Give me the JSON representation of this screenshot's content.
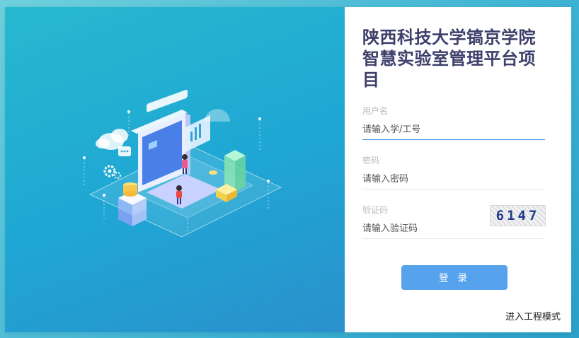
{
  "app": {
    "title": "陕西科技大学镐京学院智慧实验室管理平台项目"
  },
  "form": {
    "username": {
      "label": "用户名",
      "placeholder": "请输入学/工号"
    },
    "password": {
      "label": "密码",
      "placeholder": "请输入密码"
    },
    "captcha": {
      "label": "验证码",
      "placeholder": "请输入验证码",
      "image_text": "6147"
    }
  },
  "actions": {
    "login_label": "登 录",
    "engineering_mode_label": "进入工程模式"
  },
  "colors": {
    "brand_blue": "#56a2ec",
    "title_color": "#3d3f6b",
    "panel_gradient_start": "#27b9cf",
    "panel_gradient_end": "#2a91cc"
  },
  "icons": [
    "cloud-icon",
    "gear-icon",
    "server-stack-icon",
    "chat-bubble-icon"
  ]
}
